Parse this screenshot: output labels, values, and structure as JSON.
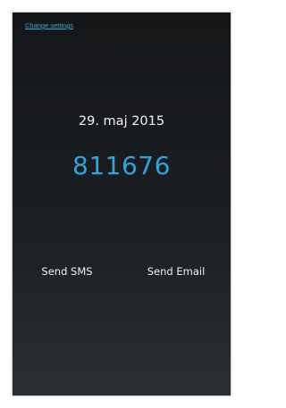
{
  "header": {
    "settings_link": "Change settings"
  },
  "main": {
    "date": "29. maj 2015",
    "code": "811676"
  },
  "actions": {
    "send_sms": "Send SMS",
    "send_email": "Send Email"
  },
  "colors": {
    "accent": "#2ea4de",
    "background_top": "#141618",
    "background_bottom": "#2b2f33",
    "text": "#f2f2f2"
  }
}
